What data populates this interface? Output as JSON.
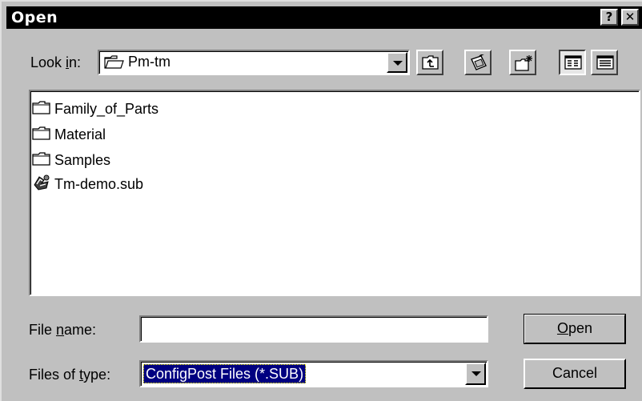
{
  "window": {
    "title": "Open",
    "help_label": "?",
    "close_label": "✕"
  },
  "look_in": {
    "label_prefix": "Look ",
    "label_accel": "i",
    "label_suffix": "n:",
    "value": "Pm-tm"
  },
  "toolbar": {
    "up_one_level_icon": "up-folder-icon",
    "desktop_icon": "desktop-icon",
    "new_folder_icon": "new-folder-icon",
    "list_view_icon": "list-view-icon",
    "details_view_icon": "details-view-icon"
  },
  "files": [
    {
      "name": "Family_of_Parts",
      "icon": "folder-icon"
    },
    {
      "name": "Material",
      "icon": "folder-icon"
    },
    {
      "name": "Samples",
      "icon": "folder-icon"
    },
    {
      "name": "Tm-demo.sub",
      "icon": "configpost-file-icon"
    }
  ],
  "file_name": {
    "label_prefix": "File ",
    "label_accel": "n",
    "label_suffix": "ame:",
    "value": ""
  },
  "files_of_type": {
    "label_prefix": "Files of ",
    "label_accel": "t",
    "label_suffix": "ype:",
    "value": "ConfigPost Files (*.SUB)"
  },
  "buttons": {
    "open_accel": "O",
    "open_rest": "pen",
    "cancel": "Cancel"
  }
}
